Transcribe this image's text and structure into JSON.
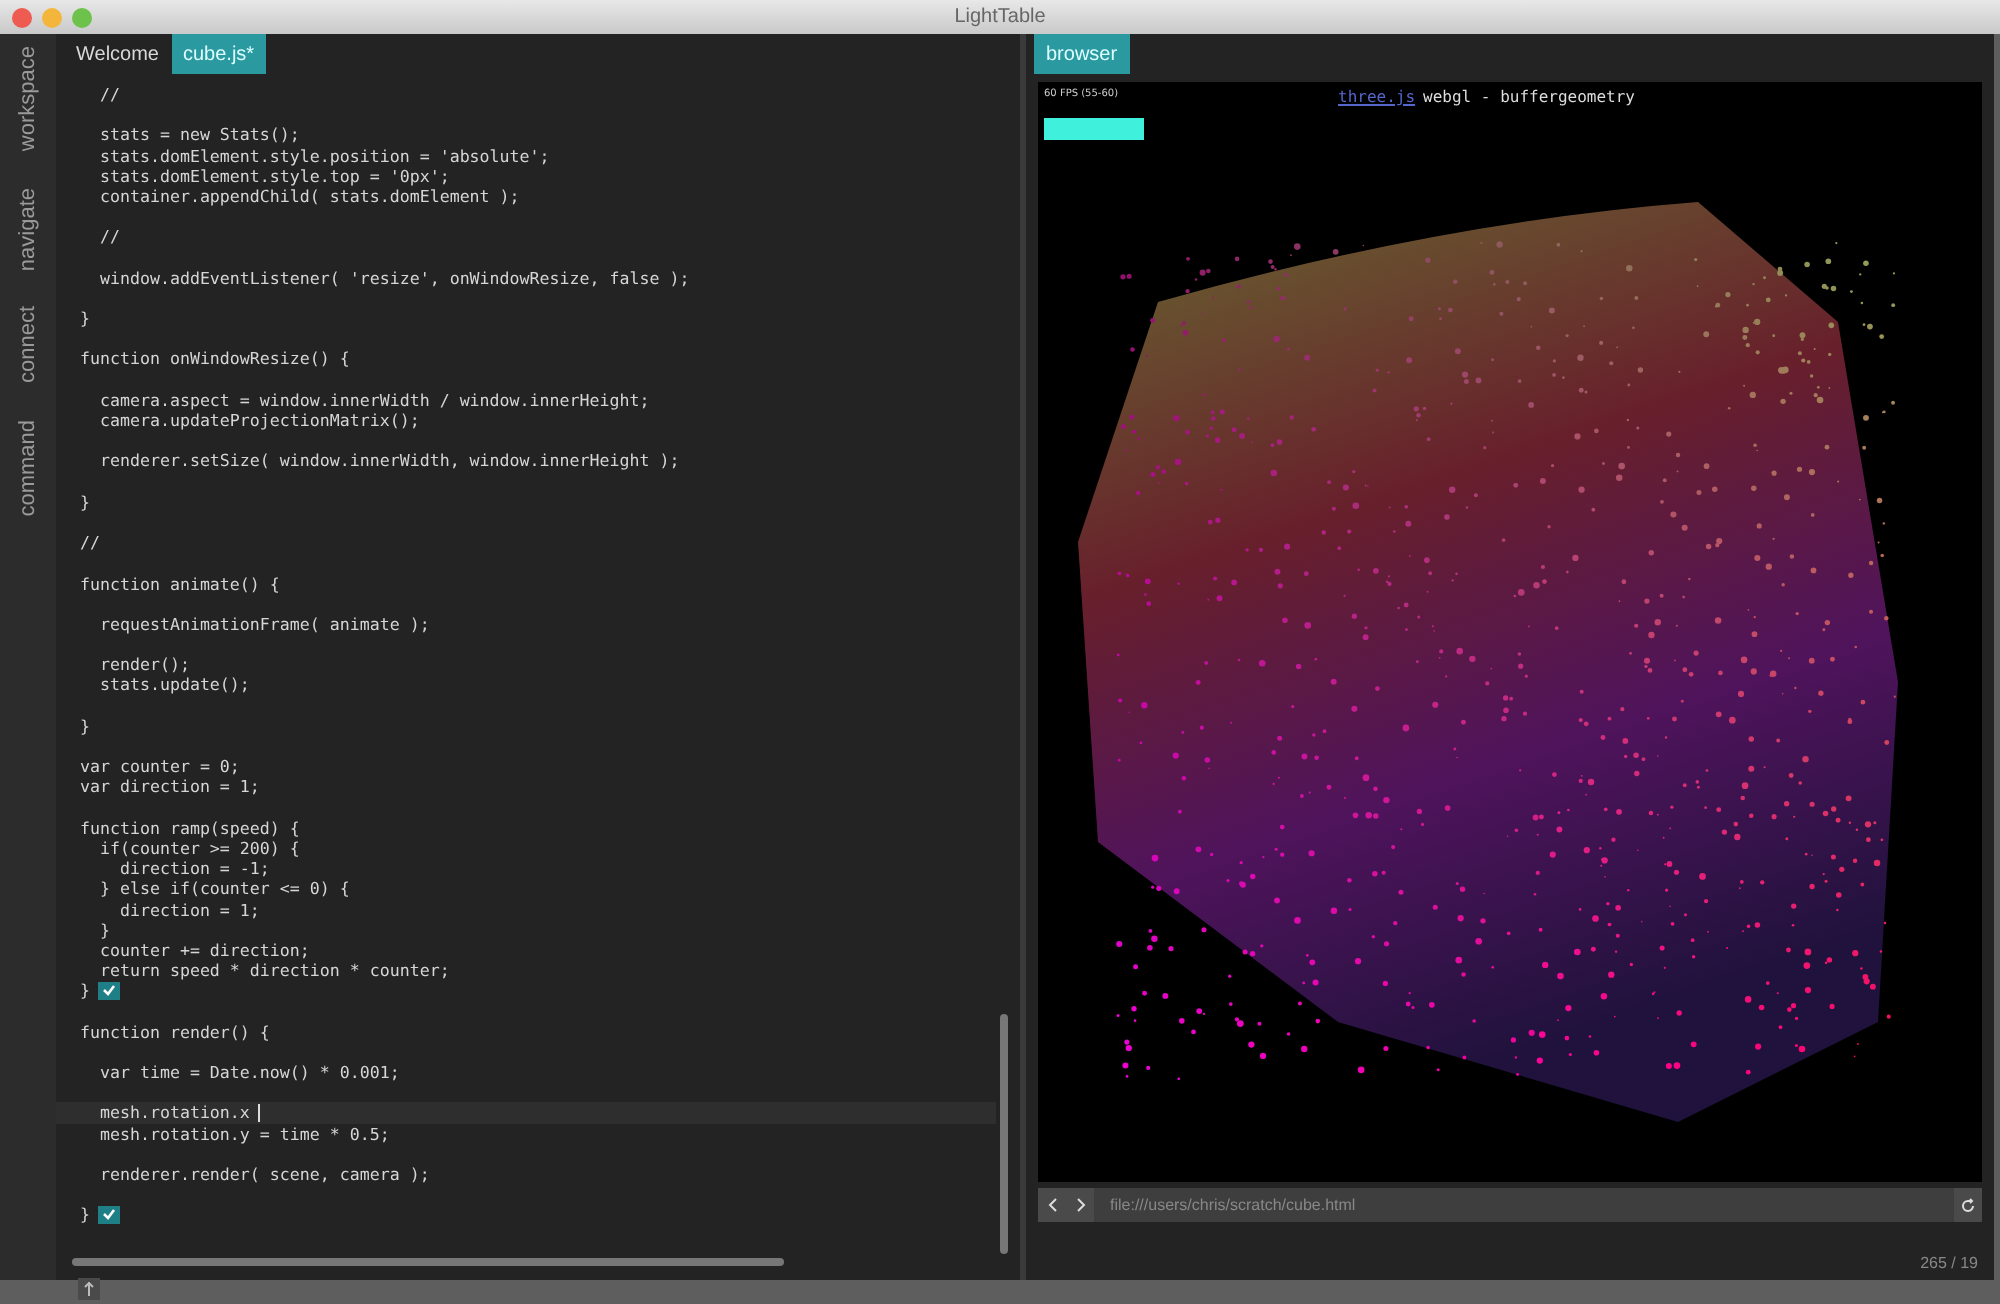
{
  "window": {
    "title": "LightTable"
  },
  "sidebar": {
    "items": [
      {
        "label": "workspace"
      },
      {
        "label": "navigate"
      },
      {
        "label": "connect"
      },
      {
        "label": "command"
      }
    ]
  },
  "editor": {
    "tabs": [
      {
        "label": "Welcome",
        "selected": false
      },
      {
        "label": "cube.js*",
        "selected": true
      }
    ],
    "lines": [
      {
        "kind": "code",
        "text": "  //"
      },
      {
        "kind": "blank"
      },
      {
        "kind": "code",
        "text": "  stats = new Stats();"
      },
      {
        "kind": "code",
        "text": "  stats.domElement.style.position = 'absolute';"
      },
      {
        "kind": "code",
        "text": "  stats.domElement.style.top = '0px';"
      },
      {
        "kind": "code",
        "text": "  container.appendChild( stats.domElement );"
      },
      {
        "kind": "blank"
      },
      {
        "kind": "code",
        "text": "  //"
      },
      {
        "kind": "blank"
      },
      {
        "kind": "code",
        "text": "  window.addEventListener( 'resize', onWindowResize, false );"
      },
      {
        "kind": "blank"
      },
      {
        "kind": "code",
        "text": "}"
      },
      {
        "kind": "blank"
      },
      {
        "kind": "code",
        "text": "function onWindowResize() {"
      },
      {
        "kind": "blank"
      },
      {
        "kind": "code",
        "text": "  camera.aspect = window.innerWidth / window.innerHeight;"
      },
      {
        "kind": "code",
        "text": "  camera.updateProjectionMatrix();"
      },
      {
        "kind": "blank"
      },
      {
        "kind": "code",
        "text": "  renderer.setSize( window.innerWidth, window.innerHeight );"
      },
      {
        "kind": "blank"
      },
      {
        "kind": "code",
        "text": "}"
      },
      {
        "kind": "blank"
      },
      {
        "kind": "code",
        "text": "//"
      },
      {
        "kind": "blank"
      },
      {
        "kind": "code",
        "text": "function animate() {"
      },
      {
        "kind": "blank"
      },
      {
        "kind": "code",
        "text": "  requestAnimationFrame( animate );"
      },
      {
        "kind": "blank"
      },
      {
        "kind": "code",
        "text": "  render();"
      },
      {
        "kind": "code",
        "text": "  stats.update();"
      },
      {
        "kind": "blank"
      },
      {
        "kind": "code",
        "text": "}"
      },
      {
        "kind": "blank"
      },
      {
        "kind": "code",
        "text": "var counter = 0;"
      },
      {
        "kind": "code",
        "text": "var direction = 1;"
      },
      {
        "kind": "blank"
      },
      {
        "kind": "code",
        "text": "function ramp(speed) {"
      },
      {
        "kind": "code",
        "text": "  if(counter >= 200) {"
      },
      {
        "kind": "code",
        "text": "    direction = -1;"
      },
      {
        "kind": "code",
        "text": "  } else if(counter <= 0) {"
      },
      {
        "kind": "code",
        "text": "    direction = 1;"
      },
      {
        "kind": "code",
        "text": "  }"
      },
      {
        "kind": "code",
        "text": "  counter += direction;"
      },
      {
        "kind": "code",
        "text": "  return speed * direction * counter;"
      },
      {
        "kind": "code",
        "text": "}",
        "evaluated": true
      },
      {
        "kind": "blank"
      },
      {
        "kind": "code",
        "text": "function render() {"
      },
      {
        "kind": "blank"
      },
      {
        "kind": "code",
        "text": "  var time = Date.now() * 0.001;"
      },
      {
        "kind": "blank"
      },
      {
        "kind": "code",
        "text": "  mesh.rotation.x",
        "cursor": true
      },
      {
        "kind": "code",
        "text": "  mesh.rotation.y = time * 0.5;"
      },
      {
        "kind": "blank"
      },
      {
        "kind": "code",
        "text": "  renderer.render( scene, camera );"
      },
      {
        "kind": "blank"
      },
      {
        "kind": "code",
        "text": "}",
        "evaluated": true
      }
    ]
  },
  "browser": {
    "tabs": [
      {
        "label": "browser",
        "selected": true
      }
    ],
    "page": {
      "fps": "60 FPS (55-60)",
      "link": "three.js",
      "heading": "webgl - buffergeometry"
    },
    "url": "file:///users/chris/scratch/cube.html"
  },
  "status_bar": {
    "position": "265 / 19"
  }
}
